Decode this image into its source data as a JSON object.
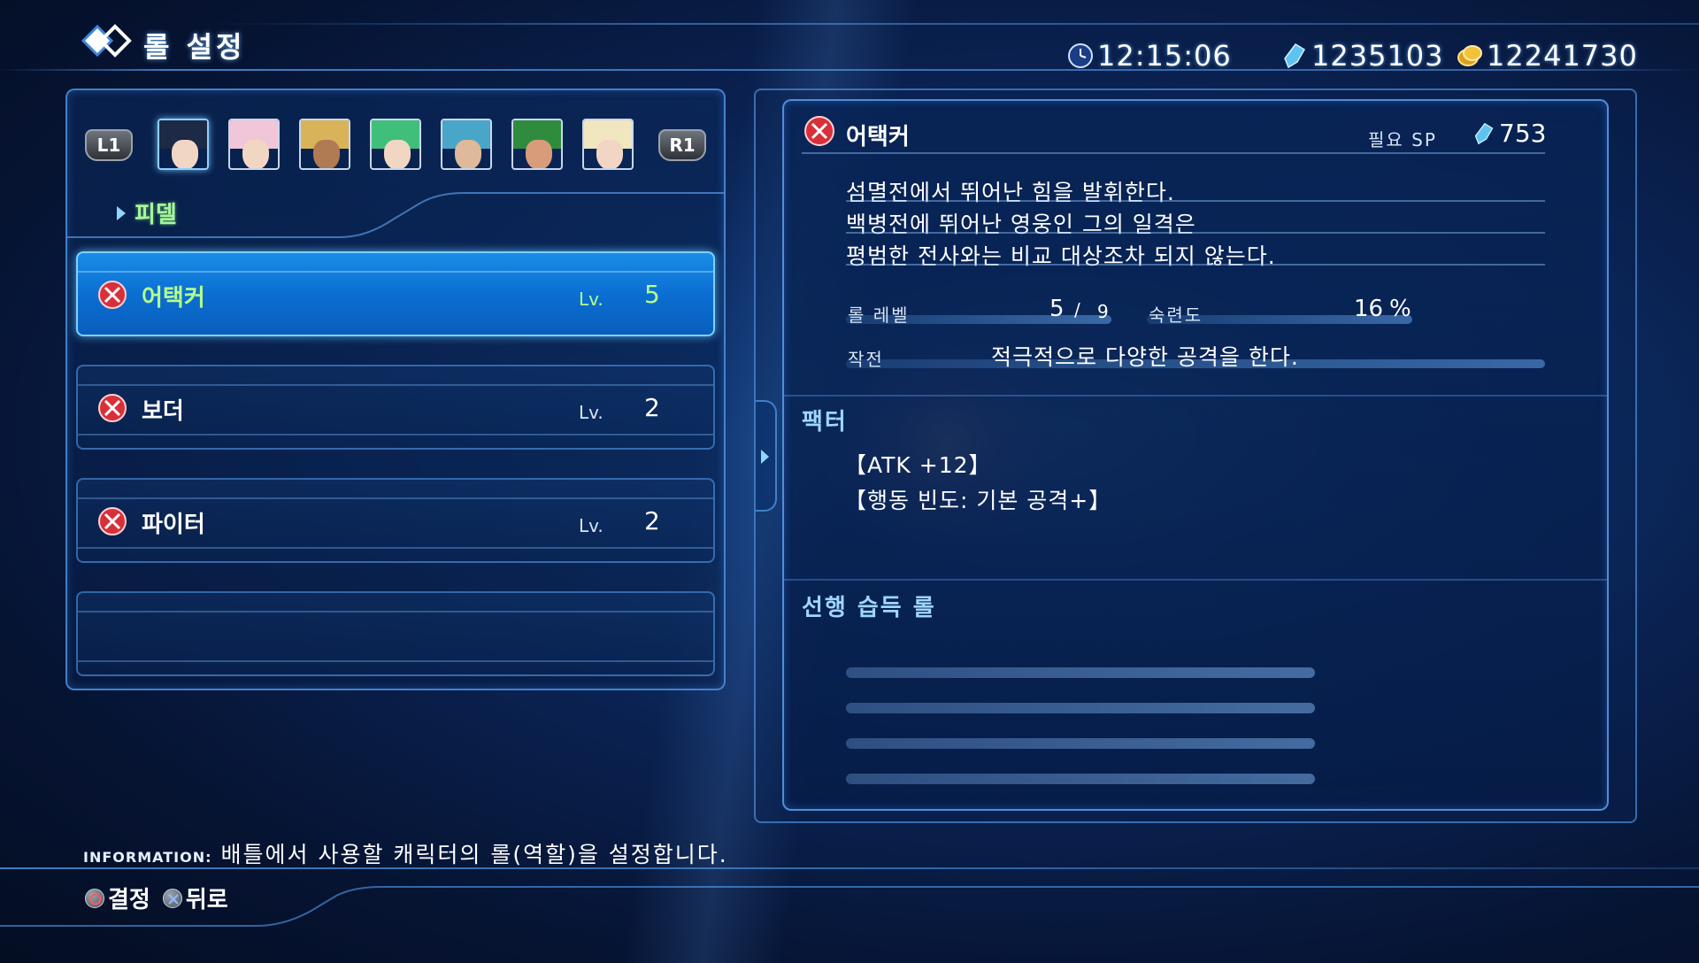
{
  "header": {
    "title": "롤 설정",
    "time": "12:15:06",
    "crystals": "1235103",
    "gold": "12241730"
  },
  "party": {
    "left_shoulder": "L1",
    "right_shoulder": "R1",
    "selected_character": "피델",
    "portraits": [
      {
        "name": "portrait-fidel",
        "hair": "#1c2a45",
        "selected": true
      },
      {
        "name": "portrait-miki",
        "hair": "#f0c6d8"
      },
      {
        "name": "portrait-fiore",
        "hair": "#d9b35a"
      },
      {
        "name": "portrait-relia",
        "hair": "#3fbf7a"
      },
      {
        "name": "portrait-victor",
        "hair": "#4aa6c8"
      },
      {
        "name": "portrait-emmerson",
        "hair": "#2f8c3f"
      },
      {
        "name": "portrait-anne",
        "hair": "#f0e6c0"
      }
    ]
  },
  "roles": [
    {
      "name": "어택커",
      "lv_label": "Lv.",
      "lv": "5",
      "active": true
    },
    {
      "name": "보더",
      "lv_label": "Lv.",
      "lv": "2"
    },
    {
      "name": "파이터",
      "lv_label": "Lv.",
      "lv": "2"
    }
  ],
  "detail": {
    "role_name": "어택커",
    "sp_label": "필요 SP",
    "sp_value": "753",
    "description": [
      "섬멸전에서 뛰어난 힘을 발휘한다.",
      "백병전에 뛰어난 영웅인 그의 일격은",
      "평범한 전사와는 비교 대상조차 되지 않는다."
    ],
    "role_level_label": "롤 레벨",
    "role_level_current": "5",
    "role_level_sep": "/",
    "role_level_max": "9",
    "proficiency_label": "숙련도",
    "proficiency_value": "16",
    "proficiency_unit": "%",
    "tactics_label": "작전",
    "tactics_value": "적극적으로 다양한 공격을 한다.",
    "factor_title": "팩터",
    "factors": [
      "【ATK +12】",
      "【행동 빈도: 기본 공격+】"
    ],
    "prereq_title": "선행 습득 롤"
  },
  "footer": {
    "info_label": "INFORMATION:",
    "info_text": "배틀에서 사용할 캐릭터의 롤(역할)을 설정합니다.",
    "confirm_label": "결정",
    "back_label": "뒤로"
  },
  "colors": {
    "accent_active": "#0b6fd2",
    "highlight_green": "#b5ff8a",
    "section_blue": "#9fd6ff"
  }
}
